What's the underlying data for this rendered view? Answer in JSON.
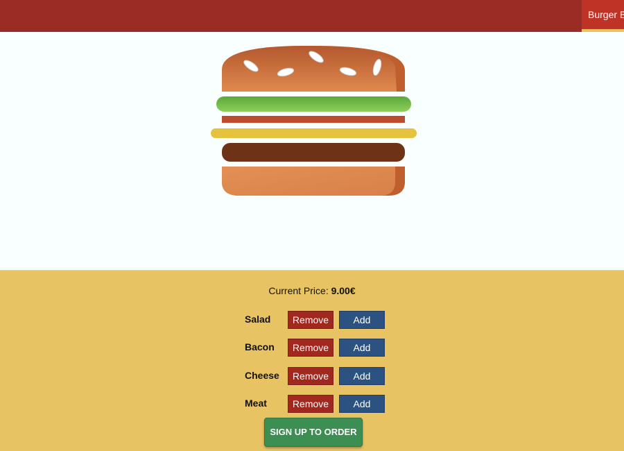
{
  "nav": {
    "brand_label": "Burger Builder",
    "accent_color": "#e8c45f",
    "bar_color": "#9b2c25",
    "active_color": "#bf3226"
  },
  "burger": {
    "layers": [
      "salad",
      "bacon",
      "cheese",
      "meat"
    ]
  },
  "builder": {
    "price_label": "Current Price:",
    "price_value": "9.00€",
    "remove_label": "Remove",
    "add_label": "Add",
    "ingredients": [
      {
        "label": "Salad"
      },
      {
        "label": "Bacon"
      },
      {
        "label": "Cheese"
      },
      {
        "label": "Meat"
      }
    ],
    "order_button": "SIGN UP TO ORDER",
    "colors": {
      "remove": "#a1281f",
      "add": "#2c5282",
      "order": "#3d8e52",
      "panel": "#e7c363"
    }
  }
}
